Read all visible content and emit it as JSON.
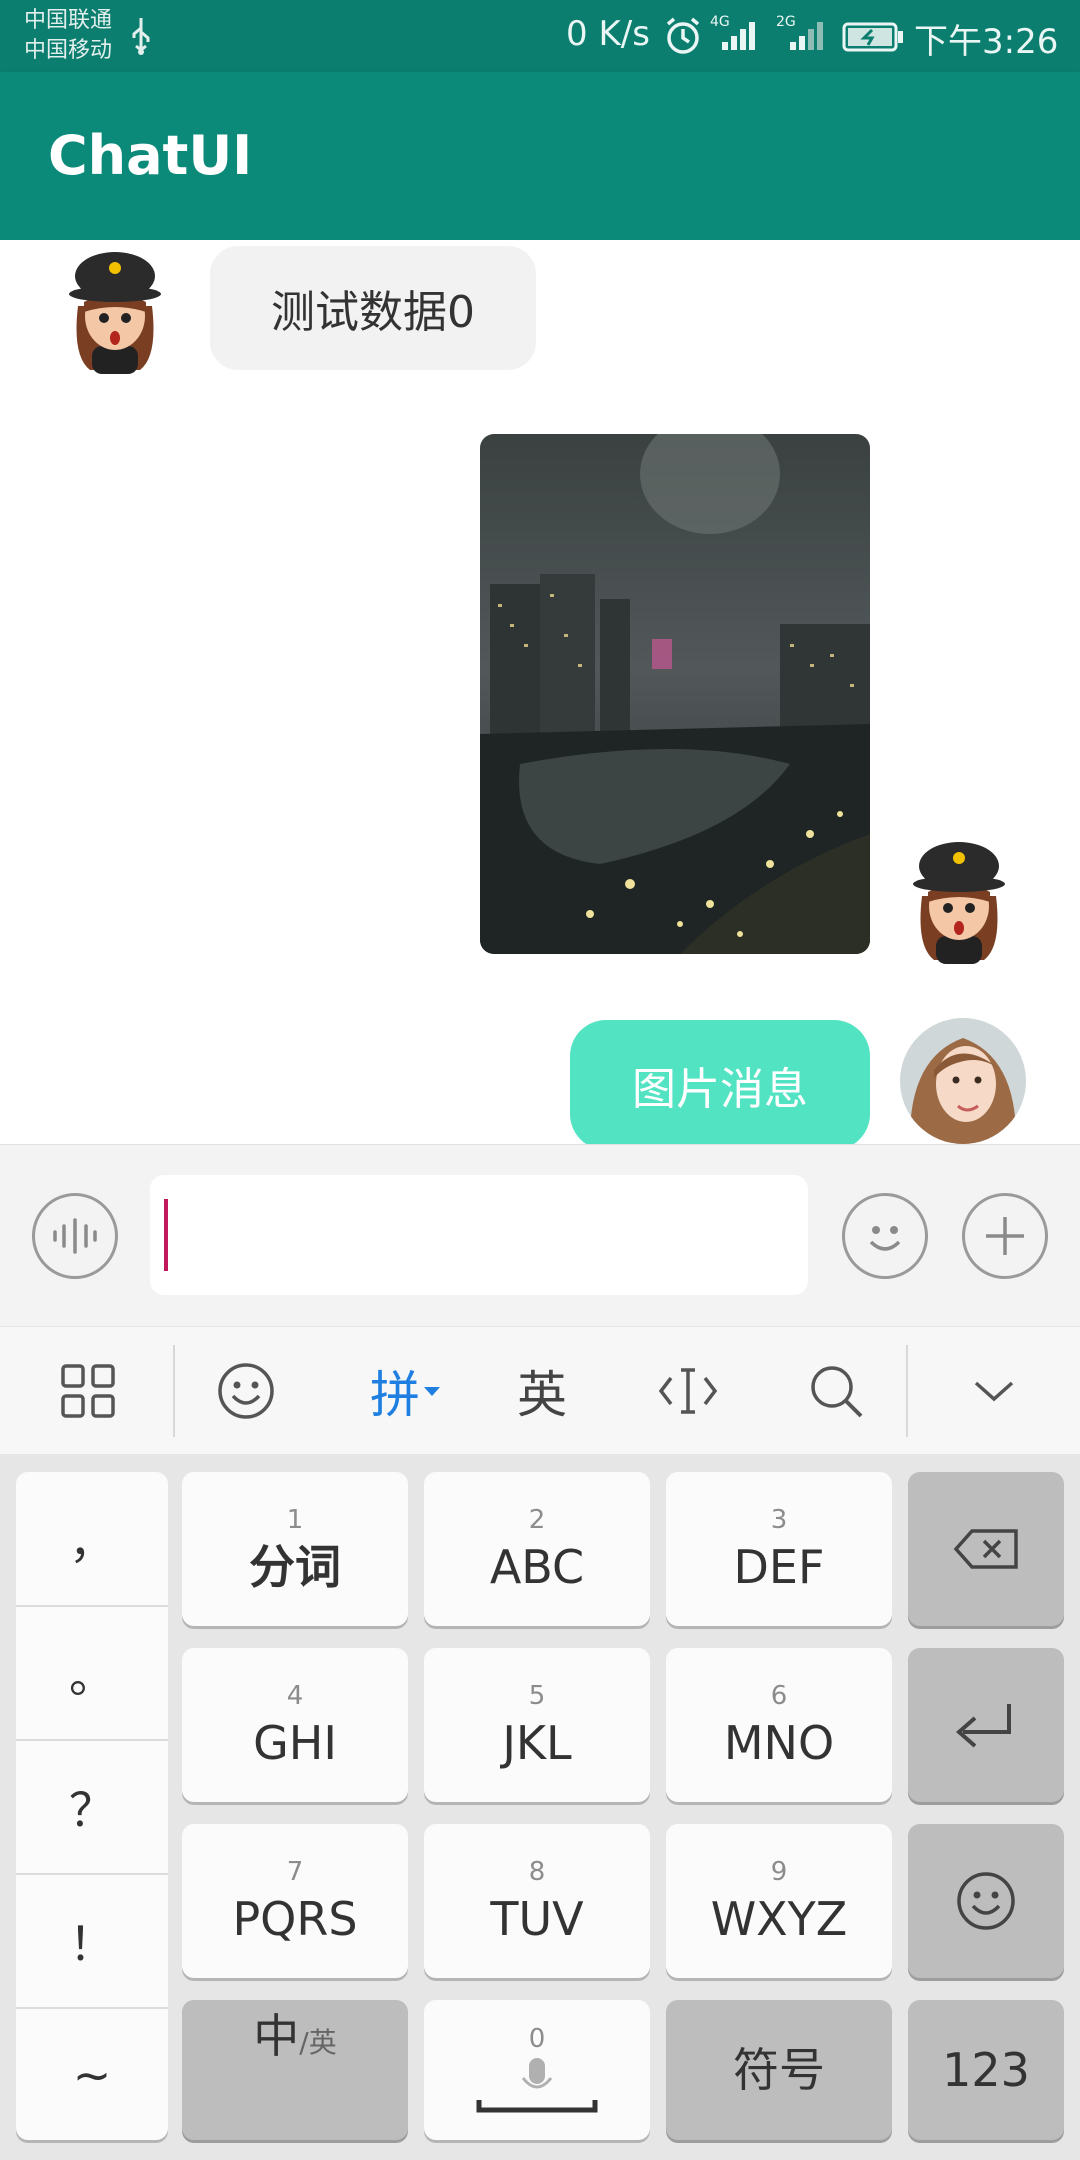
{
  "status_bar": {
    "carrier_1": "中国联通",
    "carrier_2": "中国移动",
    "net_speed": "0 K/s",
    "signal_1_label": "4G",
    "signal_2_label": "2G",
    "time": "下午3:26",
    "icons": [
      "usb-icon",
      "alarm-icon",
      "signal-icon",
      "battery-icon"
    ]
  },
  "app_bar": {
    "title": "ChatUI",
    "color": "#0c8a79"
  },
  "messages": [
    {
      "side": "left",
      "type": "text",
      "text": "测试数据0"
    },
    {
      "side": "right",
      "type": "image",
      "description_visible": false
    },
    {
      "side": "right",
      "type": "text",
      "text": "图片消息"
    }
  ],
  "input_bar": {
    "value": "",
    "icons": [
      "voice-icon",
      "emoji-icon",
      "add-icon"
    ]
  },
  "keyboard_toolbar": {
    "pinyin_label": "拼",
    "english_label": "英",
    "icons": [
      "grid-icon",
      "emoji-icon",
      "cursor-icon",
      "search-icon",
      "collapse-icon"
    ]
  },
  "keyboard": {
    "punctuation": [
      "，",
      "。",
      "？",
      "！",
      "~"
    ],
    "keys": [
      {
        "num": "1",
        "label": "分词"
      },
      {
        "num": "2",
        "label": "ABC"
      },
      {
        "num": "3",
        "label": "DEF"
      },
      {
        "num": "4",
        "label": "GHI"
      },
      {
        "num": "5",
        "label": "JKL"
      },
      {
        "num": "6",
        "label": "MNO"
      },
      {
        "num": "7",
        "label": "PQRS"
      },
      {
        "num": "8",
        "label": "TUV"
      },
      {
        "num": "9",
        "label": "WXYZ"
      }
    ],
    "space_num": "0",
    "lang_switch_main": "中",
    "lang_switch_sub": "/英",
    "symbol_label": "符号",
    "numbers_label": "123"
  }
}
